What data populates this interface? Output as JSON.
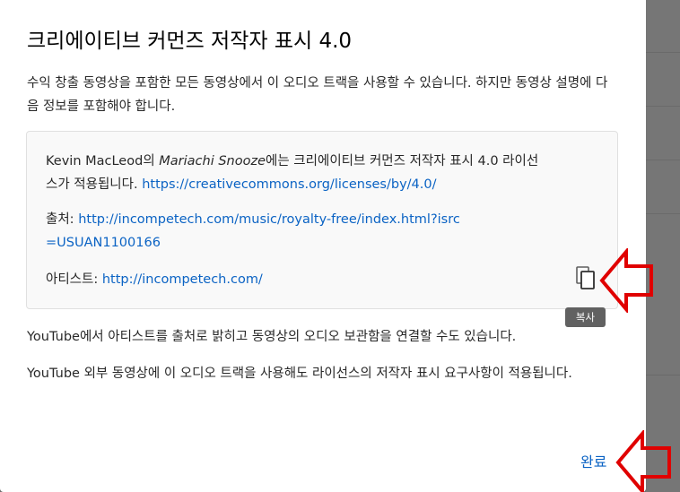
{
  "dialog": {
    "title": "크리에이티브 커먼즈 저작자 표시 4.0",
    "intro": "수익 창출 동영상을 포함한 모든 동영상에서 이 오디오 트랙을 사용할 수 있습니다. 하지만 동영상 설명에 다음 정보를 포함해야 합니다.",
    "credit": {
      "artist_name": "Kevin MacLeod",
      "particle": "의 ",
      "track_title": "Mariachi Snooze",
      "license_sentence": "에는 크리에이티브 커먼즈 저작자 표시 4.0 라이선스가 적용됩니다.",
      "license_url": "https://creativecommons.org/licenses/by/4.0/",
      "source_label": "출처:",
      "source_url": "http://incompetech.com/music/royalty-free/index.html?isrc=USUAN1100166",
      "artist_label": "아티스트:",
      "artist_url": "http://incompetech.com/"
    },
    "copy_tooltip": "복사",
    "copy_icon": "copy-icon",
    "paragraph_1": "YouTube에서 아티스트를 출처로 밝히고 동영상의 오디오 보관함을 연결할 수도 있습니다.",
    "paragraph_2": "YouTube 외부 동영상에 이 오디오 트랙을 사용해도 라이선스의 저작자 표시 요구사항이 적용됩니다.",
    "done_label": "완료"
  },
  "colors": {
    "link": "#0b63c4",
    "annotation_arrow": "#e00000",
    "tooltip_bg": "#616161"
  }
}
